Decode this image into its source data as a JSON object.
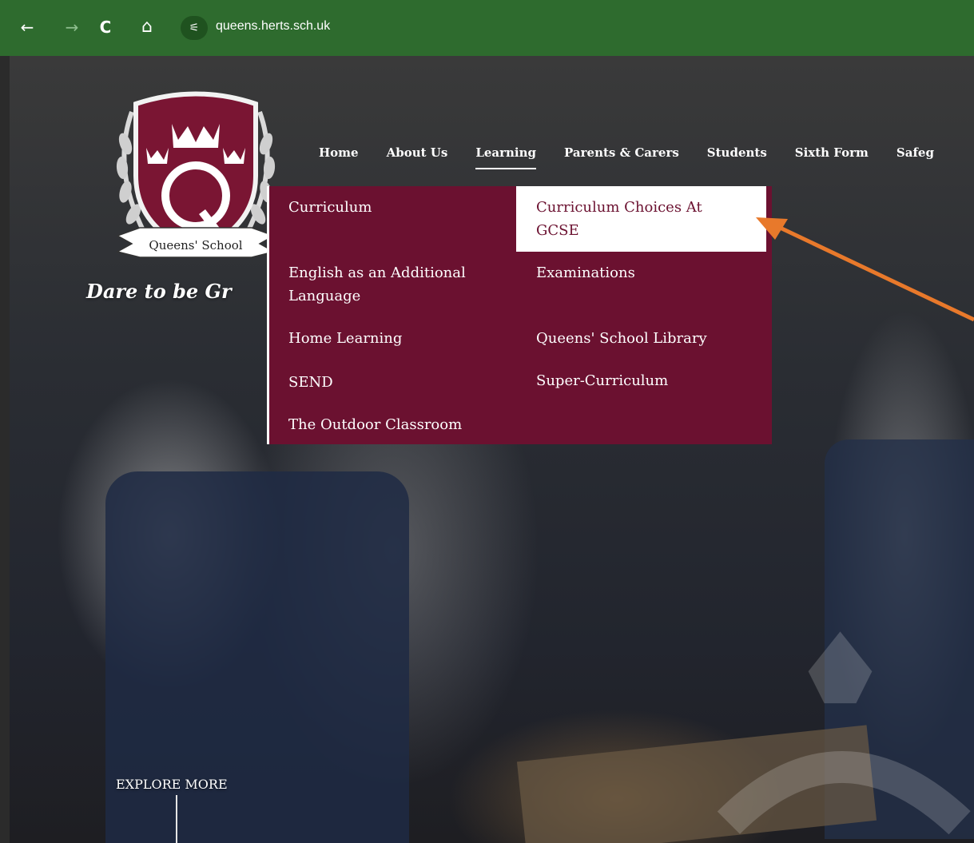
{
  "browser": {
    "url": "queens.herts.sch.uk",
    "icons": [
      "back-arrow-icon",
      "forward-arrow-icon",
      "reload-icon",
      "home-icon",
      "site-info-icon"
    ],
    "back_glyph": "←",
    "forward_glyph": "→",
    "reload_glyph": "C",
    "home_glyph": "⌂",
    "site_info_glyph": "⚟"
  },
  "logo": {
    "school_name": "Queens' School",
    "letter": "Q"
  },
  "tagline": "Dare to be Gr",
  "nav": {
    "items": [
      {
        "label": "Home"
      },
      {
        "label": "About Us"
      },
      {
        "label": "Learning"
      },
      {
        "label": "Parents & Carers"
      },
      {
        "label": "Students"
      },
      {
        "label": "Sixth Form"
      },
      {
        "label": "Safeg"
      }
    ],
    "active": "Learning"
  },
  "dropdown": {
    "left_column": [
      {
        "line1": "Curriculum",
        "line2": ""
      },
      {
        "line1": "English as an Additional",
        "line2": "Language"
      },
      {
        "line1": "Home Learning",
        "line2": ""
      },
      {
        "line1": "SEND",
        "line2": ""
      },
      {
        "line1": "The Outdoor Classroom",
        "line2": ""
      }
    ],
    "right_column": [
      {
        "line1": "Curriculum Choices At",
        "line2": "GCSE"
      },
      {
        "line1": "Examinations",
        "line2": ""
      },
      {
        "line1": "Queens' School Library",
        "line2": ""
      },
      {
        "line1": "Super-Curriculum",
        "line2": ""
      }
    ],
    "highlighted": "Curriculum Choices At GCSE"
  },
  "explore": "EXPLORE MORE",
  "colors": {
    "browser_bar": "#2e6b2e",
    "brand_maroon": "#6b1130",
    "annotation_arrow": "#e8792b"
  }
}
